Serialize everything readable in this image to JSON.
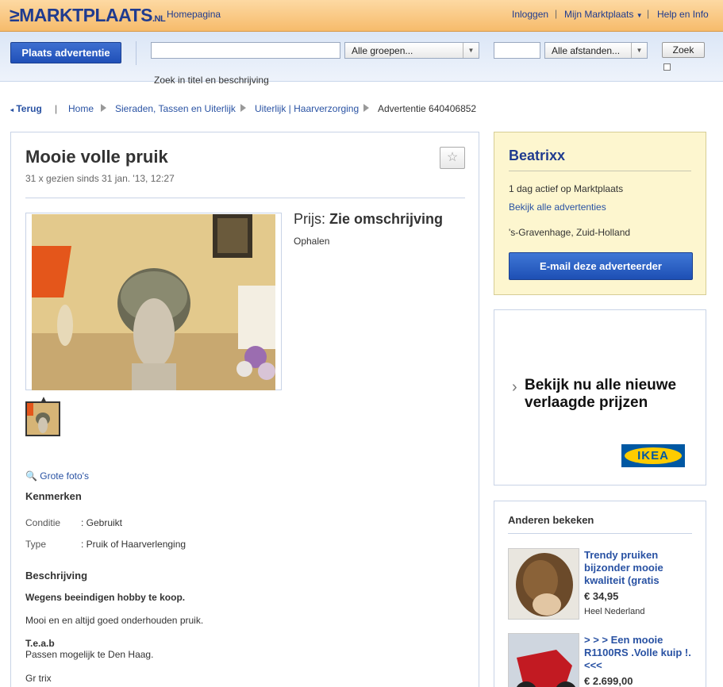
{
  "header": {
    "logo": "MARKTPLAATS",
    "logo_suffix": ".NL",
    "homepage": "Homepagina",
    "login": "Inloggen",
    "my_marktplaats": "Mijn Marktplaats",
    "help": "Help en Info"
  },
  "searchbar": {
    "place_ad": "Plaats advertentie",
    "query": "",
    "groups": "Alle groepen...",
    "postcode": "",
    "distance": "Alle afstanden...",
    "search": "Zoek",
    "hint": "Zoek in titel en beschrijving"
  },
  "breadcrumb": {
    "back": "Terug",
    "items": [
      "Home",
      "Sieraden, Tassen en Uiterlijk",
      "Uiterlijk | Haarverzorging",
      "Advertentie 640406852"
    ]
  },
  "ad": {
    "title": "Mooie volle pruik",
    "viewed": "31 x gezien sinds 31 jan. '13, 12:27",
    "price_label": "Prijs:",
    "price_value": "Zie omschrijving",
    "pickup": "Ophalen",
    "big_photos": "Grote foto's",
    "features_title": "Kenmerken",
    "features": [
      {
        "key": "Conditie",
        "value": ": Gebruikt"
      },
      {
        "key": "Type",
        "value": ": Pruik of Haarverlenging"
      }
    ],
    "description_title": "Beschrijving",
    "description": {
      "line1": "Wegens beeindigen hobby te koop.",
      "line2": "Mooi en en altijd goed onderhouden pruik.",
      "line3": "T.e.a.b",
      "line4": "Passen mogelijk te Den Haag.",
      "line5": "Gr trix"
    }
  },
  "seller": {
    "name": "Beatrixx",
    "active": "1 dag actief op Marktplaats",
    "all_ads": "Bekijk alle advertenties",
    "location": "'s-Gravenhage, Zuid-Holland",
    "email": "E-mail deze adverteerder"
  },
  "ad_banner": {
    "text": "Bekijk nu alle nieuwe verlaagde prijzen",
    "brand": "IKEA"
  },
  "others": {
    "title": "Anderen bekeken",
    "items": [
      {
        "title": "Trendy pruiken bijzonder mooie kwaliteit (gratis",
        "price": "€ 34,95",
        "location": "Heel Nederland"
      },
      {
        "title": "> > > Een mooie R1100RS .Volle kuip !.<<<",
        "price": "€ 2.699,00"
      }
    ]
  },
  "colors": {
    "brand_blue": "#1f3b8f",
    "link_blue": "#2952a3",
    "header_orange": "#f6bb6b",
    "seller_yellow": "#fdf6cf"
  }
}
